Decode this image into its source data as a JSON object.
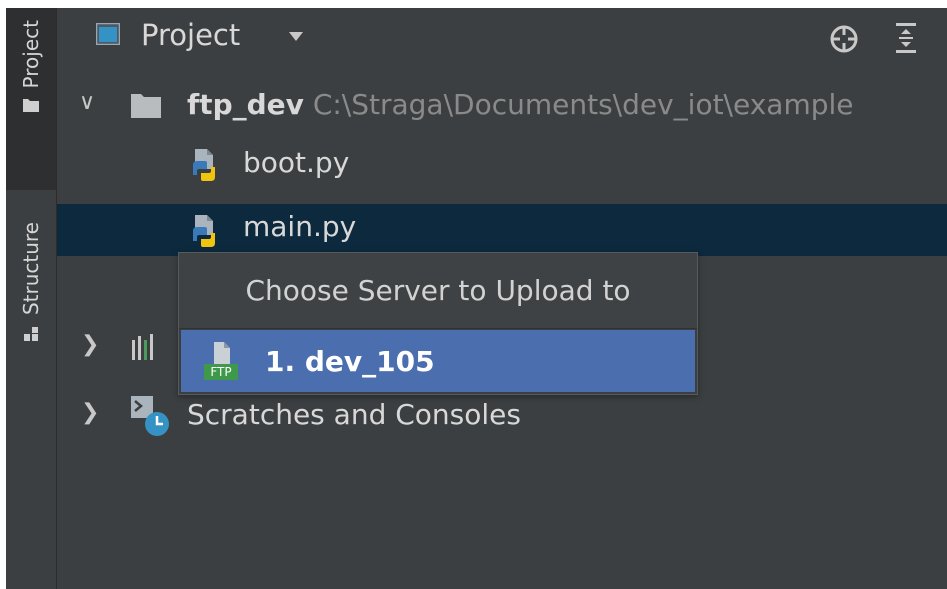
{
  "stripe": {
    "project_label": "Project",
    "structure_label": "Structure"
  },
  "header": {
    "title": "Project"
  },
  "tree": {
    "root": {
      "name": "ftp_dev",
      "path": "C:\\Straga\\Documents\\dev_iot\\example"
    },
    "files": [
      {
        "name": "boot.py"
      },
      {
        "name": "main.py",
        "selected": true
      }
    ],
    "scratches": "Scratches and Consoles"
  },
  "popup": {
    "title": "Choose Server to Upload to",
    "items": [
      {
        "label": "1. dev_105",
        "icon": "ftp-icon",
        "icon_text": "FTP"
      }
    ]
  },
  "colors": {
    "background": "#3c3f41",
    "selection": "#0d293e",
    "popup_highlight": "#4b6eaf"
  }
}
